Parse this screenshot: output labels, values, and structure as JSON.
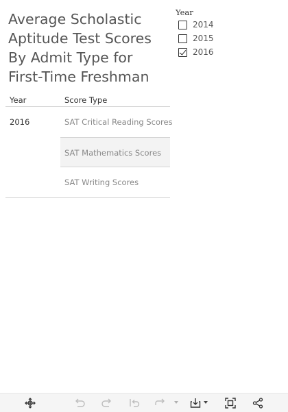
{
  "dashboard": {
    "title": "Average Scholastic Aptitude Test Scores By Admit Type for First-Time Freshman"
  },
  "filter": {
    "label": "Year",
    "options": [
      {
        "label": "2014",
        "checked": false
      },
      {
        "label": "2015",
        "checked": false
      },
      {
        "label": "2016",
        "checked": true
      }
    ]
  },
  "table": {
    "headers": {
      "year": "Year",
      "score_type": "Score Type"
    },
    "year_value": "2016",
    "score_types": [
      "SAT Critical Reading Scores",
      "SAT Mathematics Scores",
      "SAT Writing Scores"
    ]
  },
  "toolbar": {
    "icons": [
      "move-icon",
      "undo-icon",
      "redo-icon",
      "revert-icon",
      "refresh-icon",
      "download-icon",
      "fullscreen-icon",
      "share-icon"
    ]
  }
}
